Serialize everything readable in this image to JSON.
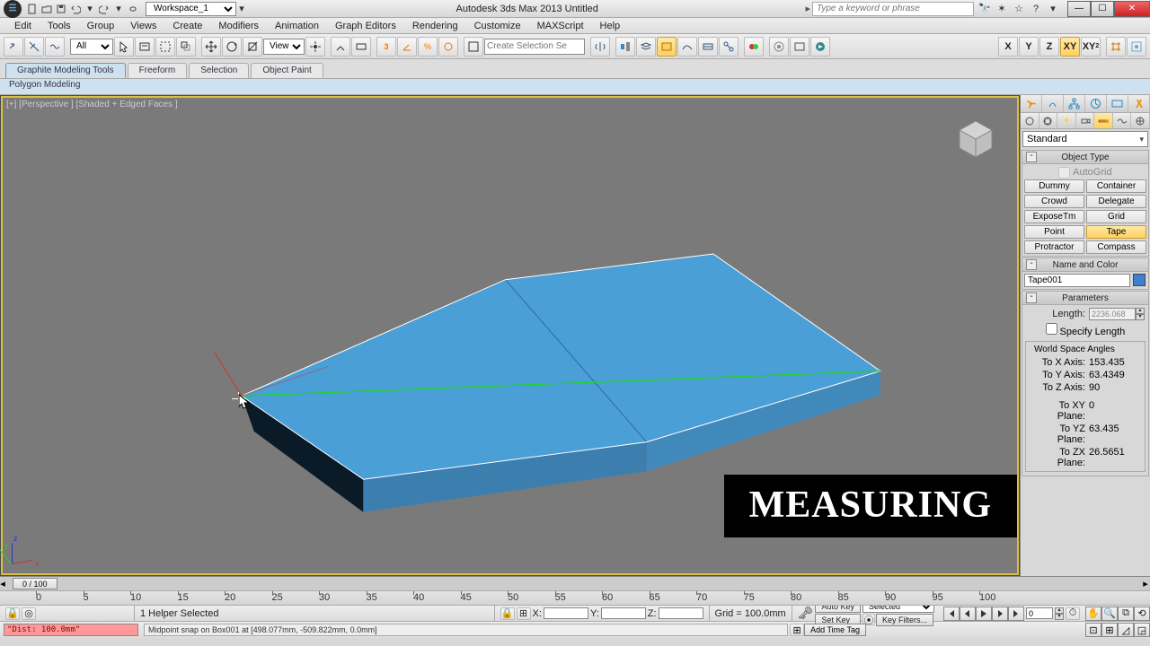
{
  "title": "Autodesk 3ds Max 2013   Untitled",
  "workspace": "Workspace_1",
  "search_placeholder": "Type a keyword or phrase",
  "menus": [
    "Edit",
    "Tools",
    "Group",
    "Views",
    "Create",
    "Modifiers",
    "Animation",
    "Graph Editors",
    "Rendering",
    "Customize",
    "MAXScript",
    "Help"
  ],
  "ribbon_tabs": [
    "Graphite Modeling Tools",
    "Freeform",
    "Selection",
    "Object Paint"
  ],
  "ribbon_active": 0,
  "sub_ribbon": "Polygon Modeling",
  "selection_filter": "All",
  "view_dropdown": "View",
  "named_selection_placeholder": "Create Selection Se",
  "axis_labels": {
    "x": "X",
    "y": "Y",
    "z": "Z",
    "xy": "XY",
    "xy2": "XY²"
  },
  "viewport_label": "[+] [Perspective ] [Shaded + Edged Faces ]",
  "overlay_text": "MEASURING",
  "cmd": {
    "category": "Standard",
    "rollouts": {
      "object_type": {
        "title": "Object Type",
        "autogrid_label": "AutoGrid",
        "buttons": [
          "Dummy",
          "Container",
          "Crowd",
          "Delegate",
          "ExposeTm",
          "Grid",
          "Point",
          "Tape",
          "Protractor",
          "Compass"
        ],
        "active": "Tape"
      },
      "name_color": {
        "title": "Name and Color",
        "name": "Tape001"
      },
      "parameters": {
        "title": "Parameters",
        "length_label": "Length:",
        "length_value": "2236.068",
        "specify_label": "Specify Length",
        "world_angles_title": "World Space Angles",
        "angles": [
          {
            "label": "To X Axis:",
            "value": "153.435"
          },
          {
            "label": "To Y Axis:",
            "value": "63.4349"
          },
          {
            "label": "To Z Axis:",
            "value": "90"
          }
        ],
        "planes": [
          {
            "label": "To XY Plane:",
            "value": "0"
          },
          {
            "label": "To YZ Plane:",
            "value": "63.435"
          },
          {
            "label": "To ZX Plane:",
            "value": "26.5651"
          }
        ]
      }
    }
  },
  "time": {
    "slider": "0 / 100",
    "ticks": [
      0,
      5,
      10,
      15,
      20,
      25,
      30,
      35,
      40,
      45,
      50,
      55,
      60,
      65,
      70,
      75,
      80,
      85,
      90,
      95,
      100
    ]
  },
  "status": {
    "selection": "1 Helper Selected",
    "coords": {
      "x": "",
      "y": "",
      "z": ""
    },
    "grid": "Grid = 100.0mm",
    "auto_key": "Auto Key",
    "set_key": "Set Key",
    "selected": "Selected",
    "key_filters": "Key Filters...",
    "add_time_tag": "Add Time Tag"
  },
  "listener": "\"Dist: 100.0mm\"",
  "prompt": "Midpoint snap on Box001 at [498.077mm, -509.822mm, 0.0mm]",
  "frame_spinner": "0"
}
